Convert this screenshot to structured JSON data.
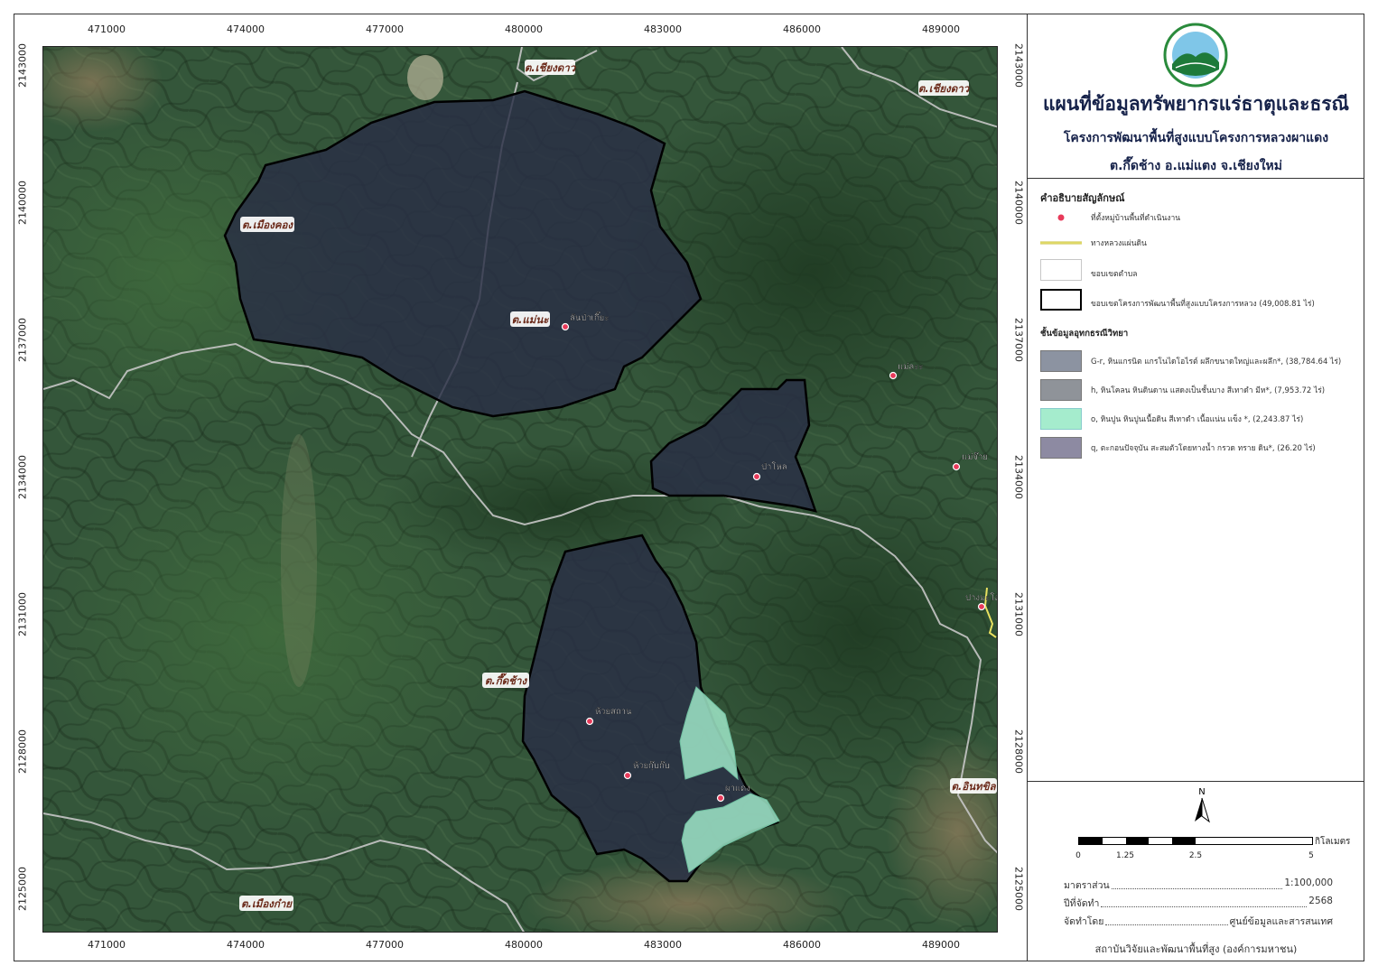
{
  "map": {
    "grid_x_labels": [
      "471000",
      "474000",
      "477000",
      "480000",
      "483000",
      "486000",
      "489000"
    ],
    "grid_y_labels": [
      "2143000",
      "2140000",
      "2137000",
      "2134000",
      "2131000",
      "2128000",
      "2125000"
    ],
    "subdistrict_labels": [
      {
        "id": "chiangdao-1",
        "text": "ต.เชียงดาว"
      },
      {
        "id": "chiangdao-2",
        "text": "ต.เชียงดาว"
      },
      {
        "id": "mueangkhong",
        "text": "ต.เมืองคอง"
      },
      {
        "id": "maena",
        "text": "ต.แม่นะ"
      },
      {
        "id": "kuetchang",
        "text": "ต.กึ๊ดช้าง"
      },
      {
        "id": "inthakhin",
        "text": "ต.อินทขิล"
      },
      {
        "id": "mueangkai",
        "text": "ต.เมืองก๋าย"
      }
    ],
    "villages": [
      {
        "id": "lanpatia",
        "text": "ลันป่าเกี๊ยะ"
      },
      {
        "id": "maelae",
        "text": "แม่ละะ"
      },
      {
        "id": "papen",
        "text": "ป่าโหล"
      },
      {
        "id": "maeja",
        "text": "แม่จ๊าย"
      },
      {
        "id": "pangmaio",
        "text": "ปางมะโอ"
      },
      {
        "id": "huaysathan",
        "text": "ห้วยสถาน"
      },
      {
        "id": "huaykupkap",
        "text": "ห้วยกุ๊บก๊บ"
      },
      {
        "id": "phadaeng",
        "text": "ผาแดง"
      }
    ],
    "colors": {
      "project_fill": "#2a2e45",
      "project_border": "#000000",
      "limestone_fill": "#9fe6c8",
      "road": "#c7c7c7",
      "highway": "#e8e060",
      "village_marker": "#e83a5a"
    }
  },
  "panel": {
    "title_main": "แผนที่ข้อมูลทรัพยากรแร่ธาตุและธรณี",
    "title_sub": "โครงการพัฒนาพื้นที่สูงแบบโครงการหลวงผาแดง",
    "title_loc": "ต.กึ๊ดช้าง อ.แม่แตง จ.เชียงใหม่",
    "legend_title": "คำอธิบายสัญลักษณ์",
    "legend": [
      {
        "id": "village",
        "label": "ที่ตั้งหมู่บ้านพื้นที่ดำเนินงาน",
        "icon": "village-marker-icon"
      },
      {
        "id": "highway",
        "label": "ทางหลวงแผ่นดิน",
        "color": "#e8e060"
      },
      {
        "id": "subdistrict",
        "label": "ขอบเขตตำบล"
      },
      {
        "id": "project",
        "label": "ขอบเขตโครงการพัฒนาพื้นที่สูงแบบโครงการหลวง (49,008.81 ไร่)"
      }
    ],
    "geology_title": "ชั้นข้อมูลอุทกธรณีวิทยา",
    "geology": [
      {
        "id": "gr",
        "label": "G-r,  หินแกรนิต แกรโนไดโอไรต์ ผลึกขนาดใหญ่และผลึก*, (38,784.64 ไร่)",
        "color": "#8c93a1"
      },
      {
        "id": "h",
        "label": "h,  หินโคลน หินดินดาน แสดงเป็นชั้นบาง สีเทาดำ มีห*, (7,953.72 ไร่)",
        "color": "#8f9399"
      },
      {
        "id": "o",
        "label": "o,  หินปูน หินปูนเนื้อดิน สีเทาดำ เนื้อแน่น แข็ง *, (2,243.87 ไร่)",
        "color": "#a5eccd"
      },
      {
        "id": "q",
        "label": "q,  ตะกอนปัจจุบัน สะสมตัวโดยทางน้ำ กรวด  ทราย ดิน*, (26.20 ไร่)",
        "color": "#8d8aa2"
      }
    ],
    "north_label": "N",
    "scale_ticks": [
      "0",
      "1.25",
      "2.5",
      "5"
    ],
    "scale_unit": "กิโลเมตร",
    "scale_label": "มาตราส่วน",
    "scale_value": "1:100,000",
    "year_label": "ปีที่จัดทำ",
    "year_value": "2568",
    "maker_label": "จัดทำโดย",
    "maker_value": "ศูนย์ข้อมูลและสารสนเทศ",
    "institute": "สถาบันวิจัยและพัฒนาพื้นที่สูง (องค์การมหาชน)"
  }
}
